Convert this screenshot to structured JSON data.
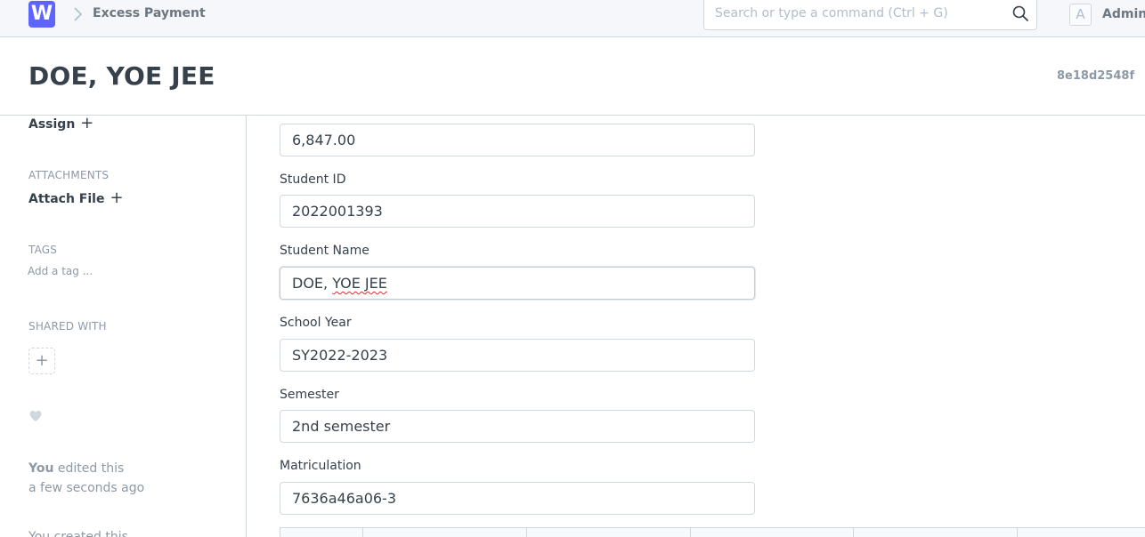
{
  "app": {
    "logo_letter": "W",
    "brand_color": "#5e64ff"
  },
  "breadcrumb": {
    "label": "Excess Payment"
  },
  "search": {
    "placeholder": "Search or type a command (Ctrl + G)"
  },
  "user": {
    "avatar_letter": "A",
    "name": "Administrator"
  },
  "doc": {
    "title": "DOE, YOE JEE",
    "id": "8e18d2548f"
  },
  "sidebar": {
    "assign_label": "Assign",
    "attachments_heading": "ATTACHMENTS",
    "attach_label": "Attach File",
    "tags_heading": "TAGS",
    "tag_placeholder": "Add a tag ...",
    "shared_heading": "SHARED WITH",
    "activity_user": "You",
    "activity_text": "edited this",
    "activity_time": "a few seconds ago",
    "activity_cut": "You created this"
  },
  "form": {
    "amount": "6,847.00",
    "fields": [
      {
        "label": "Student ID",
        "value": "2022001393"
      },
      {
        "label": "Student Name",
        "value_part1": "DOE, ",
        "value_part2": "YOE JEE"
      },
      {
        "label": "School Year",
        "value": "SY2022-2023"
      },
      {
        "label": "Semester",
        "value": "2nd semester"
      },
      {
        "label": "Matriculation",
        "value": "7636a46a06-3"
      }
    ]
  }
}
